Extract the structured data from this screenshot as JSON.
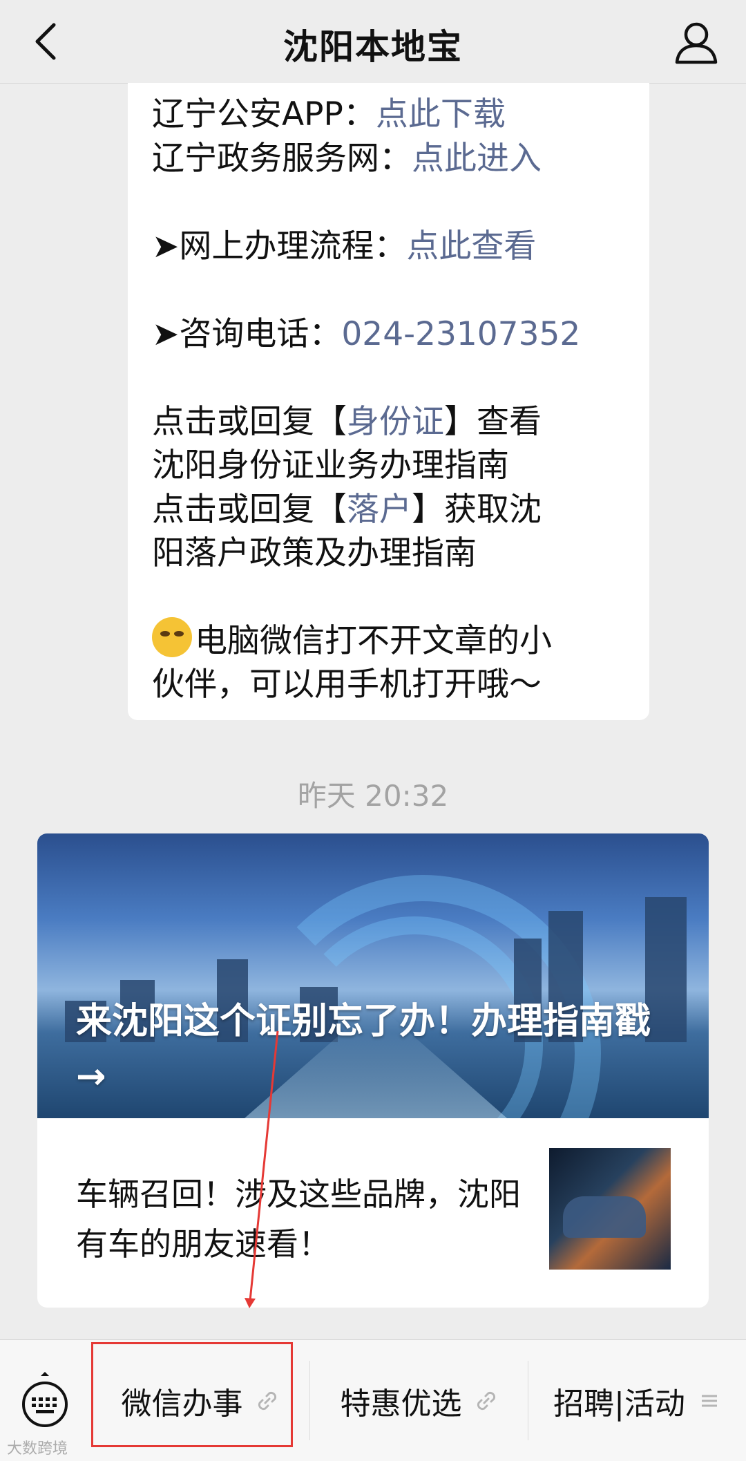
{
  "header": {
    "title": "沈阳本地宝"
  },
  "message": {
    "lines": [
      {
        "label": "辽宁公安APP：",
        "link": "点此下载"
      },
      {
        "label": "辽宁政务服务网：",
        "link": "点此进入"
      },
      {
        "label": "➤网上办理流程：",
        "link": "点此查看"
      },
      {
        "label": "➤咨询电话：",
        "link": "024-23107352"
      }
    ],
    "idcard": {
      "prefix": "点击或回复【",
      "link": "身份证",
      "suffix": "】查看",
      "line2": "沈阳身份证业务办理指南"
    },
    "hukou": {
      "prefix": "点击或回复【",
      "link": "落户",
      "suffix": "】获取沈",
      "line2": "阳落户政策及办理指南"
    },
    "tip": {
      "line1": "电脑微信打不开文章的小",
      "line2": "伙伴，可以用手机打开哦～"
    }
  },
  "timestamp": "昨天 20:32",
  "article": {
    "cover_title": "来沈阳这个证别忘了办！办理指南戳 →",
    "item_title": "车辆召回！涉及这些品牌，沈阳有车的朋友速看！"
  },
  "menu": {
    "items": [
      {
        "label": "微信办事",
        "icon": "link-icon"
      },
      {
        "label": "特惠优选",
        "icon": "link-icon"
      },
      {
        "label": "招聘|活动",
        "icon": "list-icon"
      }
    ]
  },
  "watermark": "大数跨境",
  "colors": {
    "link": "#5b6a91",
    "highlight": "#e53935"
  }
}
